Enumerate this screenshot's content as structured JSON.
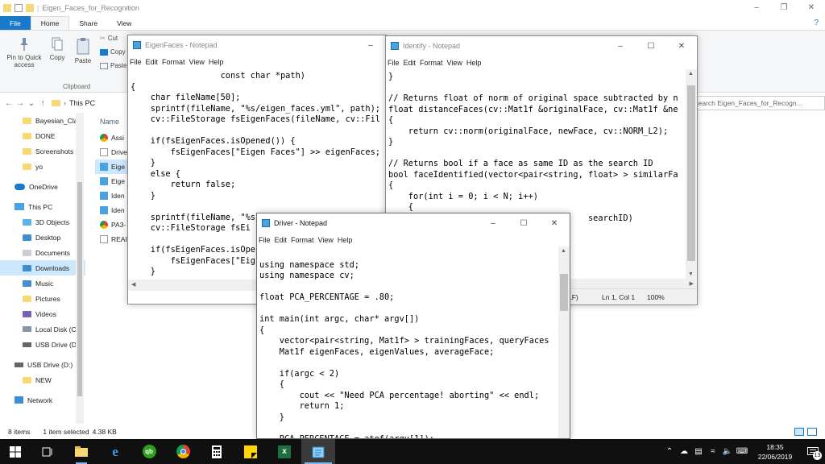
{
  "explorer": {
    "title": "Eigen_Faces_for_Recognition",
    "tabs": [
      "File",
      "Home",
      "Share",
      "View"
    ],
    "ribbon": {
      "pin_label": "Pin to Quick access",
      "copy_label": "Copy",
      "paste_label": "Paste",
      "cut_label": "Cut",
      "copy_path_label": "Copy",
      "paste_shortcut_label": "Paste",
      "group_label": "Clipboard"
    },
    "breadcrumb": "This PC",
    "search_placeholder": "Search Eigen_Faces_for_Recogn...",
    "nav": [
      {
        "label": "Bayesian_Cla",
        "icon": "folder-icon"
      },
      {
        "label": "DONE",
        "icon": "folder-icon"
      },
      {
        "label": "Screenshots",
        "icon": "folder-icon"
      },
      {
        "label": "yo",
        "icon": "folder-icon"
      },
      {
        "label": "OneDrive",
        "icon": "cloud-icon"
      },
      {
        "label": "This PC",
        "icon": "computer-icon"
      },
      {
        "label": "3D Objects",
        "icon": "folder-icon"
      },
      {
        "label": "Desktop",
        "icon": "folder-icon"
      },
      {
        "label": "Documents",
        "icon": "folder-icon"
      },
      {
        "label": "Downloads",
        "icon": "download-folder-icon"
      },
      {
        "label": "Music",
        "icon": "music-folder-icon"
      },
      {
        "label": "Pictures",
        "icon": "folder-icon"
      },
      {
        "label": "Videos",
        "icon": "folder-icon"
      },
      {
        "label": "Local Disk (C",
        "icon": "drive-icon"
      },
      {
        "label": "USB Drive (D",
        "icon": "usb-drive-icon"
      },
      {
        "label": "USB Drive (D:)",
        "icon": "usb-drive-icon"
      },
      {
        "label": "NEW",
        "icon": "folder-icon"
      },
      {
        "label": "Network",
        "icon": "network-icon"
      }
    ],
    "column_header": "Name",
    "files": [
      "Assi",
      "Drive",
      "Eige",
      "Eige",
      "Iden",
      "Iden",
      "PA3-",
      "REAI"
    ],
    "status": {
      "count": "8 items",
      "selection": "1 item selected",
      "size": "4.38 KB"
    }
  },
  "notepads": {
    "eigenfaces": {
      "title": "EigenFaces - Notepad",
      "menu": [
        "File",
        "Edit",
        "Format",
        "View",
        "Help"
      ],
      "code": "                  const char *path)\n{\n    char fileName[50];\n    sprintf(fileName, \"%s/eigen_faces.yml\", path);\n    cv::FileStorage fsEigenFaces(fileName, cv::Fil\n\n    if(fsEigenFaces.isOpened()) {\n        fsEigenFaces[\"Eigen Faces\"] >> eigenFaces;\n    }\n    else {\n        return false;\n    }\n\n    sprintf(fileName, \"%s\n    cv::FileStorage fsEi\n\n    if(fsEigenFaces.isOpe\n        fsEigenFaces[\"Eig\n    }"
    },
    "identify": {
      "title": "Identify - Notepad",
      "menu": [
        "File",
        "Edit",
        "Format",
        "View",
        "Help"
      ],
      "code": "}\n\n// Returns float of norm of original space subtracted by n\nfloat distanceFaces(cv::Mat1f &originalFace, cv::Mat1f &ne\n{\n    return cv::norm(originalFace, newFace, cv::NORM_L2);\n}\n\n// Returns bool if a face as same ID as the search ID\nbool faceIdentified(vector<pair<string, float> > similarFa\n{\n    for(int i = 0; i < N; i++)\n    {\n                                        searchID)",
      "status_encoding": "LF)",
      "status_position": "Ln 1, Col 1",
      "status_zoom": "100%"
    },
    "driver": {
      "title": "Driver - Notepad",
      "menu": [
        "File",
        "Edit",
        "Format",
        "View",
        "Help"
      ],
      "code": "\nusing namespace std;\nusing namespace cv;\n\nfloat PCA_PERCENTAGE = .80;\n\nint main(int argc, char* argv[])\n{\n    vector<pair<string, Mat1f> > trainingFaces, queryFaces\n    Mat1f eigenFaces, eigenValues, averageFace;\n\n    if(argc < 2)\n    {\n        cout << \"Need PCA percentage! aborting\" << endl;\n        return 1;\n    }\n\n    PCA_PERCENTAGE = atof(argv[1]);"
    }
  },
  "taskbar": {
    "time": "18:35",
    "date": "22/06/2019",
    "notification_count": "13",
    "apps": [
      "start-icon",
      "task-view-icon",
      "file-explorer-icon",
      "edge-icon",
      "quickbooks-icon",
      "chrome-icon",
      "calculator-icon",
      "sticky-notes-icon",
      "excel-icon",
      "notepad-icon"
    ]
  },
  "colors": {
    "accent": "#1979ca",
    "selection": "#cce8ff",
    "taskbar": "#101010",
    "folder": "#f8d775"
  }
}
